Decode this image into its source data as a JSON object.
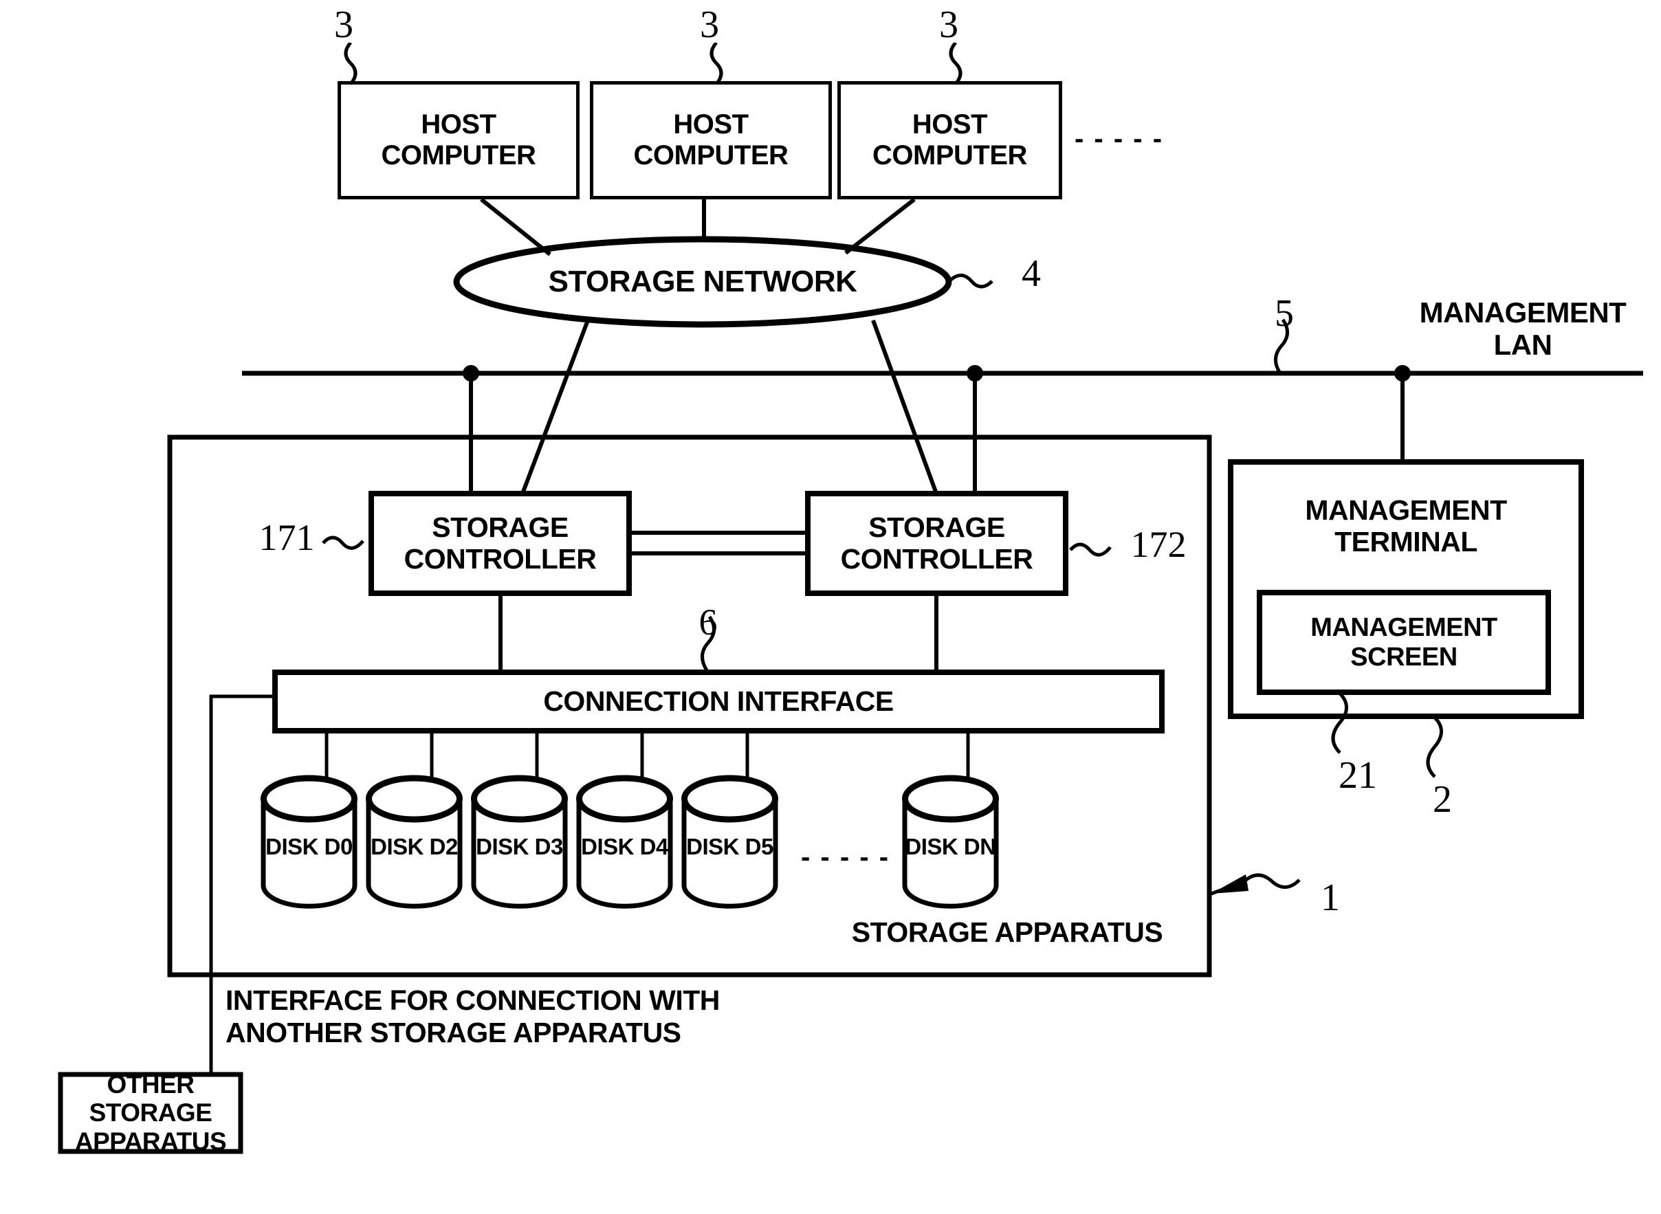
{
  "figure": {
    "kind": "patent-block-diagram",
    "ink_color": "#000000",
    "background": "#ffffff"
  },
  "hosts": [
    {
      "label": "HOST\nCOMPUTER",
      "ref": "3"
    },
    {
      "label": "HOST\nCOMPUTER",
      "ref": "3"
    },
    {
      "label": "HOST\nCOMPUTER",
      "ref": "3"
    }
  ],
  "hosts_ellipsis": "- - - - -",
  "network": {
    "label": "STORAGE NETWORK",
    "ref": "4"
  },
  "lan": {
    "label": "MANAGEMENT\nLAN",
    "ref": "5"
  },
  "storage_apparatus": {
    "label": "STORAGE APPARATUS",
    "ref": "1",
    "controllers": [
      {
        "label": "STORAGE\nCONTROLLER",
        "ref": "171"
      },
      {
        "label": "STORAGE\nCONTROLLER",
        "ref": "172"
      }
    ],
    "connection_interface": {
      "label": "CONNECTION INTERFACE",
      "ref": "6"
    },
    "disks": [
      {
        "label": "DISK\nD0"
      },
      {
        "label": "DISK\nD2"
      },
      {
        "label": "DISK\nD3"
      },
      {
        "label": "DISK\nD4"
      },
      {
        "label": "DISK\nD5"
      },
      {
        "label": "DISK\nDN"
      }
    ],
    "disks_ellipsis": "- - - - -"
  },
  "management_terminal": {
    "label": "MANAGEMENT\nTERMINAL",
    "ref": "2",
    "screen": {
      "label": "MANAGEMENT\nSCREEN",
      "ref": "21"
    }
  },
  "external_interface": {
    "caption": "INTERFACE FOR CONNECTION WITH\nANOTHER STORAGE APPARATUS"
  },
  "other_storage_apparatus": {
    "label": "OTHER STORAGE\nAPPARATUS"
  }
}
